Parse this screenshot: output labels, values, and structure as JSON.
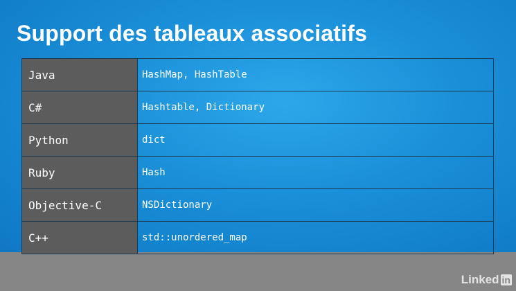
{
  "slide": {
    "title": "Support des tableaux associatifs"
  },
  "table": {
    "rows": [
      {
        "language": "Java",
        "implementation": "HashMap, HashTable"
      },
      {
        "language": "C#",
        "implementation": "Hashtable, Dictionary"
      },
      {
        "language": "Python",
        "implementation": "dict"
      },
      {
        "language": "Ruby",
        "implementation": "Hash"
      },
      {
        "language": "Objective-C",
        "implementation": "NSDictionary"
      },
      {
        "language": "C++",
        "implementation": "std::unordered_map"
      }
    ]
  },
  "watermark": {
    "brand_text": "Linked",
    "brand_badge": "in"
  },
  "colors": {
    "slide_background": "#1a8fd8",
    "language_cell": "#5c5c5c",
    "footer_bar": "#868686",
    "text": "#ffffff"
  }
}
